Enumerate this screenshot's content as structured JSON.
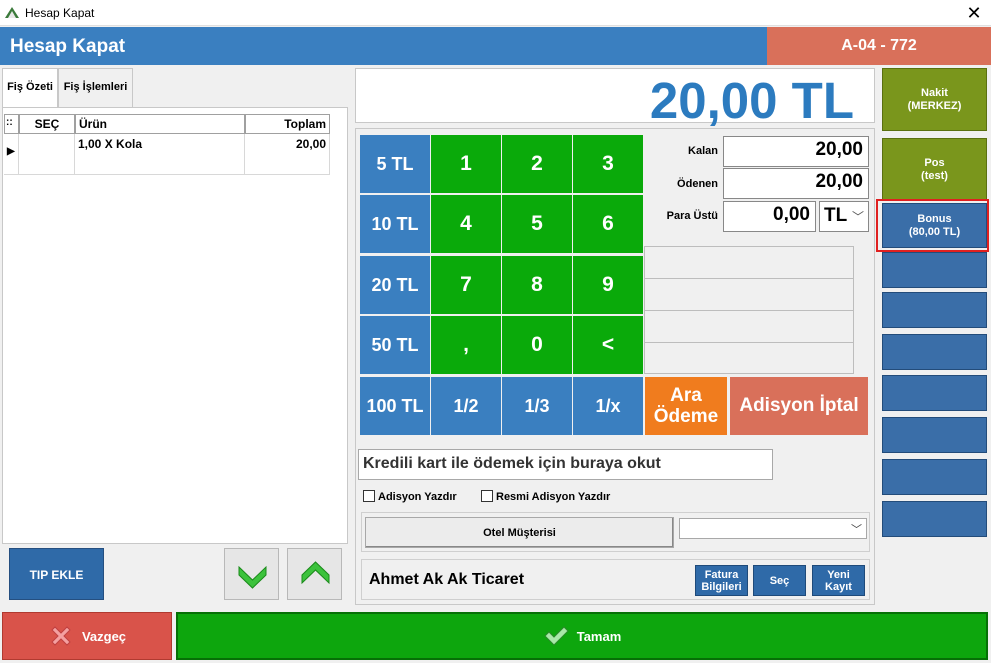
{
  "window": {
    "title": "Hesap Kapat",
    "close_glyph": "✕"
  },
  "header": {
    "title": "Hesap Kapat",
    "table_code": "A-04 - 772"
  },
  "tabs": [
    {
      "label": "Fiş Özeti",
      "active": true
    },
    {
      "label": "Fiş İşlemleri",
      "active": false
    }
  ],
  "grid": {
    "corner": "::",
    "columns": [
      "SEÇ",
      "Ürün",
      "Toplam"
    ],
    "rows": [
      {
        "indicator": "▶",
        "sec": "",
        "urun": "1,00 X Kola",
        "toplam": "20,00"
      }
    ]
  },
  "left_buttons": {
    "tip_ekle": "TIP EKLE",
    "down_icon": "chevron-down-icon",
    "up_icon": "chevron-up-icon"
  },
  "total": "20,00 TL",
  "keypad": {
    "quick": [
      "5 TL",
      "10 TL",
      "20 TL",
      "50 TL",
      "100 TL"
    ],
    "digits": [
      "1",
      "2",
      "3",
      "4",
      "5",
      "6",
      "7",
      "8",
      "9",
      ",",
      "0",
      "<"
    ],
    "fractions": [
      "1/2",
      "1/3",
      "1/x"
    ],
    "ara_odeme_1": "Ara",
    "ara_odeme_2": "Ödeme",
    "adisyon_iptal": "Adisyon İptal"
  },
  "amounts": {
    "kalan_label": "Kalan",
    "kalan": "20,00",
    "odenen_label": "Ödenen",
    "odenen": "20,00",
    "para_ustu_label": "Para Üstü",
    "para_ustu": "0,00",
    "currency": "TL"
  },
  "card_input": {
    "value": "Kredili kart ile ödemek için buraya okut"
  },
  "checkboxes": {
    "adisyon_yazdir": "Adisyon Yazdır",
    "resmi_adisyon_yazdir": "Resmi Adisyon Yazdır"
  },
  "otel": {
    "button": "Otel Müşterisi",
    "select_value": ""
  },
  "customer": {
    "name": "Ahmet Ak Ak Ticaret",
    "fatura_1": "Fatura",
    "fatura_2": "Bilgileri",
    "sec": "Seç",
    "yeni_1": "Yeni",
    "yeni_2": "Kayıt"
  },
  "payment_methods": [
    {
      "line1": "Nakit",
      "line2": "(MERKEZ)"
    },
    {
      "line1": "Pos",
      "line2": "(test)"
    },
    {
      "line1": "Bonus",
      "line2": "(80,00 TL)"
    }
  ],
  "footer": {
    "vazgec": "Vazgeç",
    "tamam": "Tamam"
  },
  "colors": {
    "header": "#3a7fc0",
    "table_code": "#d9705a",
    "green": "#0aaa0a",
    "orange": "#f07c1e",
    "olive": "#7a961c"
  }
}
